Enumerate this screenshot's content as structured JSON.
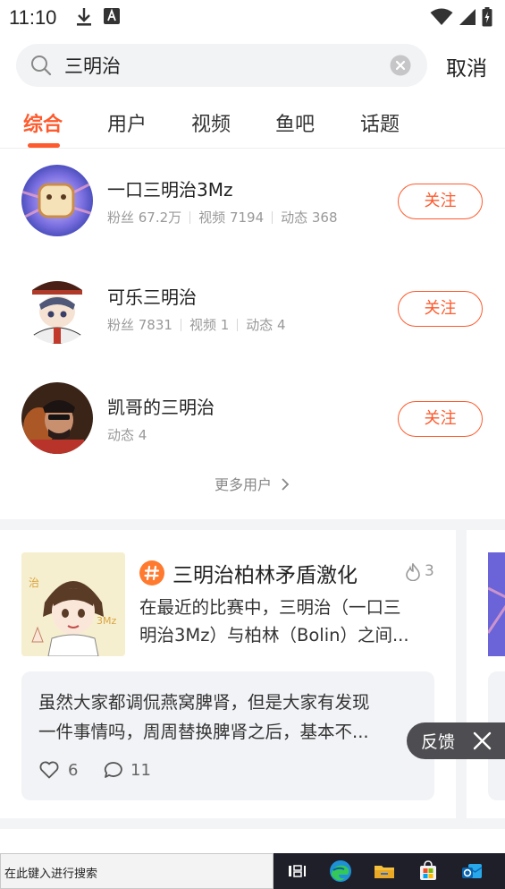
{
  "status_bar": {
    "time": "11:10"
  },
  "search": {
    "query": "三明治",
    "cancel_label": "取消"
  },
  "tabs": [
    {
      "label": "综合"
    },
    {
      "label": "用户"
    },
    {
      "label": "视频"
    },
    {
      "label": "鱼吧"
    },
    {
      "label": "话题"
    }
  ],
  "users": [
    {
      "name": "一口三明治3Mz",
      "fans": "粉丝 67.2万",
      "videos": "视频 7194",
      "posts": "动态 368",
      "follow_label": "关注"
    },
    {
      "name": "可乐三明治",
      "fans": "粉丝 7831",
      "videos": "视频 1",
      "posts": "动态 4",
      "follow_label": "关注"
    },
    {
      "name": "凯哥的三明治",
      "posts": "动态 4",
      "follow_label": "关注"
    }
  ],
  "more_users_label": "更多用户",
  "topic": {
    "title": "三明治柏林矛盾激化",
    "hot_count": "3",
    "desc_line1": "在最近的比赛中，三明治（一口三",
    "desc_line2": "明治3Mz）与柏林（Bolin）之间...",
    "comment_line1": "虽然大家都调侃燕窝脾肾，但是大家有发现",
    "comment_line2": "一件事情吗，周周替换脾肾之后，基本不...",
    "likes": "6",
    "replies": "11"
  },
  "feedback_label": "反馈",
  "taskbar": {
    "search_placeholder": "在此键入进行搜索"
  },
  "colors": {
    "accent": "#fe5a2d",
    "hash_orange": "#ff7a2f"
  }
}
